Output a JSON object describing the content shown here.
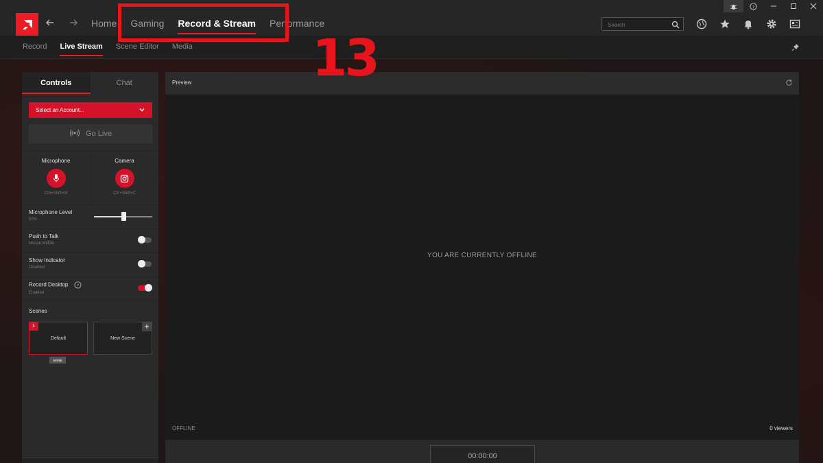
{
  "titlebar": {
    "window_controls": [
      "bug-icon",
      "help-icon",
      "minimize-icon",
      "maximize-icon",
      "close-icon"
    ],
    "main_nav": [
      "Home",
      "Gaming",
      "Record & Stream",
      "Performance"
    ],
    "active_nav": "Record & Stream",
    "search_placeholder": "Search",
    "top_icons": [
      "globe-icon",
      "star-icon",
      "bell-icon",
      "gear-icon",
      "account-icon"
    ]
  },
  "subnav": {
    "items": [
      "Record",
      "Live Stream",
      "Scene Editor",
      "Media"
    ],
    "active": "Live Stream"
  },
  "annotation": {
    "number": "13",
    "color": "#e8141b"
  },
  "panel": {
    "tabs": [
      "Controls",
      "Chat"
    ],
    "active_tab": "Controls",
    "account_select": "Select an Account...",
    "go_live": "Go Live",
    "microphone": {
      "label": "Microphone",
      "hotkey": "Ctrl+Shift+M"
    },
    "camera": {
      "label": "Camera",
      "hotkey": "Ctrl+Shift+C"
    },
    "mic_level": {
      "label": "Microphone Level",
      "value_text": "50%",
      "value": 0.5
    },
    "push_to_talk": {
      "label": "Push to Talk",
      "sub": "Mouse Middle",
      "on": false
    },
    "show_indicator": {
      "label": "Show Indicator",
      "sub": "Disabled",
      "on": false
    },
    "record_desktop": {
      "label": "Record Desktop",
      "sub": "Enabled",
      "on": true
    },
    "scenes_label": "Scenes",
    "scenes": [
      {
        "name": "Default",
        "number": "1",
        "badge": "NONE"
      },
      {
        "name": "New Scene"
      }
    ]
  },
  "preview": {
    "title": "Preview",
    "message": "YOU ARE CURRENTLY OFFLINE",
    "status": "OFFLINE",
    "viewers": "0 viewers",
    "timer": "00:00:00"
  },
  "colors": {
    "accent": "#ed1c24",
    "button_red": "#d6112a",
    "panel": "#2a2a2a"
  }
}
